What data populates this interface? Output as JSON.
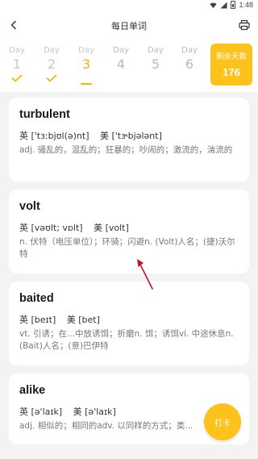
{
  "status": {
    "time": "1:48"
  },
  "header": {
    "title": "每日单词"
  },
  "days": [
    {
      "label": "Day",
      "number": "1",
      "state": "done"
    },
    {
      "label": "Day",
      "number": "2",
      "state": "done"
    },
    {
      "label": "Day",
      "number": "3",
      "state": "current"
    },
    {
      "label": "Day",
      "number": "4",
      "state": "upcoming"
    },
    {
      "label": "Day",
      "number": "5",
      "state": "upcoming"
    },
    {
      "label": "Day",
      "number": "6",
      "state": "upcoming"
    }
  ],
  "remaining": {
    "label": "剩余天数",
    "value": "176"
  },
  "words": [
    {
      "word": "turbulent",
      "uk": "英 ['tɜːbjʊl(ə)nt]",
      "us": "美 ['tɝbjələnt]",
      "definition": "adj. 骚乱的，混乱的；狂暴的；吵闹的；激流的，湍流的"
    },
    {
      "word": "volt",
      "uk": "英 [vəʊlt; vɒlt]",
      "us": "美 [volt]",
      "definition": "n. 伏特（电压单位）；环骑；闪避n. (Volt)人名；(捷)沃尔特"
    },
    {
      "word": "baited",
      "uk": "英 [beɪt]",
      "us": "美 [bet]",
      "definition": "vt. 引诱；在...中放诱饵；折磨n. 饵；诱饵vi. 中途休息n. (Bait)人名；(意)巴伊特"
    },
    {
      "word": "alike",
      "uk": "英 [ə'laɪk]",
      "us": "美 [ə'laɪk]",
      "definition": "adj. 相似的；相同的adv. 以同样的方式；类..."
    }
  ],
  "checkin": {
    "label": "打卡"
  },
  "colors": {
    "accent": "#ffc21a",
    "annotation": "#c8102e"
  }
}
